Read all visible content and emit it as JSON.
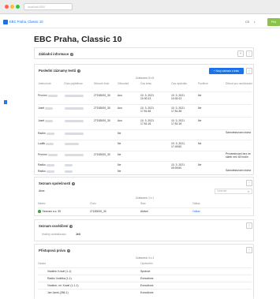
{
  "browser": {
    "url": "localhost:3000"
  },
  "app": {
    "title": "EBC Praha, Classic 10",
    "language": "CS",
    "add_label": "Přid"
  },
  "page": {
    "title": "EBC Praha, Classic 10"
  },
  "basic_info": {
    "title": "Základní informace"
  },
  "tests": {
    "title": "Poslední záznamy testů",
    "new_button": "+ Nový záznam z testu",
    "count": "Zobrazeno 8 z 8",
    "columns": [
      "Jméno/role",
      "Číslo pojištěnce",
      "Sériové číslo",
      "Očkování",
      "Čas testu",
      "Čas výsledku",
      "Pozitivní",
      "Důvod pro neočkování"
    ],
    "rows": [
      {
        "name": "Prvními",
        "serial": "27183000_30",
        "vacc": "Ano",
        "test": "10. 3. 2021 10:30:13",
        "result": "10. 3. 2021 10:30:13",
        "pos": "Ne",
        "reason": ""
      },
      {
        "name": "Josef",
        "serial": "27183000_30",
        "vacc": "Ano",
        "test": "10. 3. 2021 17:51:38",
        "result": "10. 3. 2021 17:51:38",
        "pos": "Ne",
        "reason": ""
      },
      {
        "name": "Josef",
        "serial": "27183000_30",
        "vacc": "Ano",
        "test": "10. 3. 2021 17:51:18",
        "result": "10. 3. 2021 17:51:18",
        "pos": "Ne",
        "reason": ""
      },
      {
        "name": "Radim",
        "serial": "",
        "vacc": "Ne",
        "test": "",
        "result": "",
        "pos": "",
        "reason": "Samotestování doma"
      },
      {
        "name": "Luděk",
        "serial": "",
        "vacc": "Ne",
        "test": "",
        "result": "10. 3. 2021 17:49:50",
        "pos": "Ne",
        "reason": ""
      },
      {
        "name": "Prvními",
        "serial": "27183000_30",
        "vacc": "Ne",
        "test": "",
        "result": "",
        "pos": "",
        "reason": "Prvotestování bez ne starší než 48 hodin"
      },
      {
        "name": "Radko",
        "serial": "",
        "vacc": "Ne",
        "test": "",
        "result": "10. 3. 2021 09:09:50",
        "pos": "Ne",
        "reason": ""
      },
      {
        "name": "Radko",
        "serial": "",
        "vacc": "Ne",
        "test": "",
        "result": "",
        "pos": "",
        "reason": "Samotestování doma"
      }
    ]
  },
  "companies": {
    "title": "Seznam společností",
    "filter_label": "Akce",
    "search_placeholder": "Vyhledat",
    "count": "Zobrazeno 1 z 1",
    "columns": [
      "Název",
      "Číslo",
      "Stav",
      "Odkaz"
    ],
    "row": {
      "name": "Seznam a.s.  35",
      "number": "27183000_30",
      "state": "Aktivní",
      "link": "Odkaz"
    }
  },
  "confirmations": {
    "title": "Seznam osvědčení",
    "label": "Hodiny osvědčování",
    "value": "Jeli"
  },
  "access": {
    "title": "Přístupová práva",
    "count": "Zobrazeno 4 z 4",
    "columns": [
      "Osoba",
      "Oprávnění"
    ],
    "rows": [
      {
        "person": "Vladimír Kovář (1-1)",
        "role": "Správce"
      },
      {
        "person": "Radko Vodička (1-1)",
        "role": "Executives"
      },
      {
        "person": "Vladimír, ml. Kovář (1-1-1)",
        "role": "Executives"
      },
      {
        "person": "Jan Jaroš (286-1)",
        "role": "Executives"
      }
    ]
  }
}
